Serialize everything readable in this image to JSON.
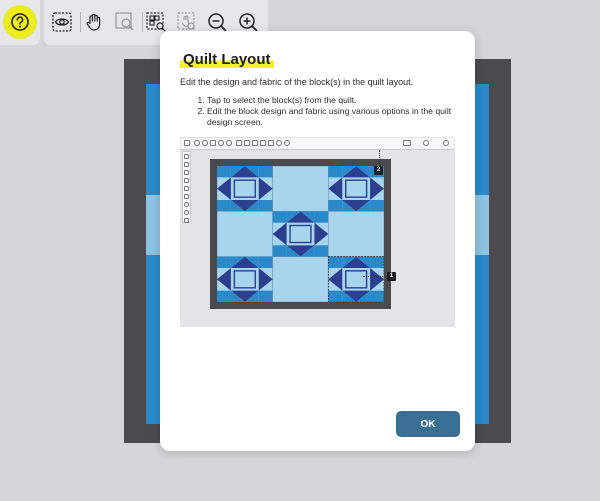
{
  "toolbar": {
    "help_icon": "question-circle-icon",
    "tools": [
      {
        "name": "eye-icon"
      },
      {
        "name": "hand-icon"
      },
      {
        "name": "zoom-selection-icon"
      },
      {
        "name": "zoom-fit-icon"
      },
      {
        "name": "zoom-region-icon"
      },
      {
        "name": "zoom-out-icon"
      },
      {
        "name": "zoom-in-icon"
      }
    ],
    "highlight_color": "#f0ee19"
  },
  "dialog": {
    "title": "Quilt Layout",
    "intro": "Edit the design and fabric of the block(s) in the quilt layout.",
    "steps": [
      "Tap to select the block(s) from the quilt.",
      "Edit the block design and fabric using various options in the quilt design screen."
    ],
    "callouts": [
      "1",
      "2"
    ],
    "ok_label": "OK",
    "ok_color": "#3a6f94"
  },
  "colors": {
    "quilt_border": "#4b4b4f",
    "quilt_blue": "#2a8ac9",
    "quilt_light": "#a9d4ee",
    "star_dark": "#2b3f8f"
  }
}
